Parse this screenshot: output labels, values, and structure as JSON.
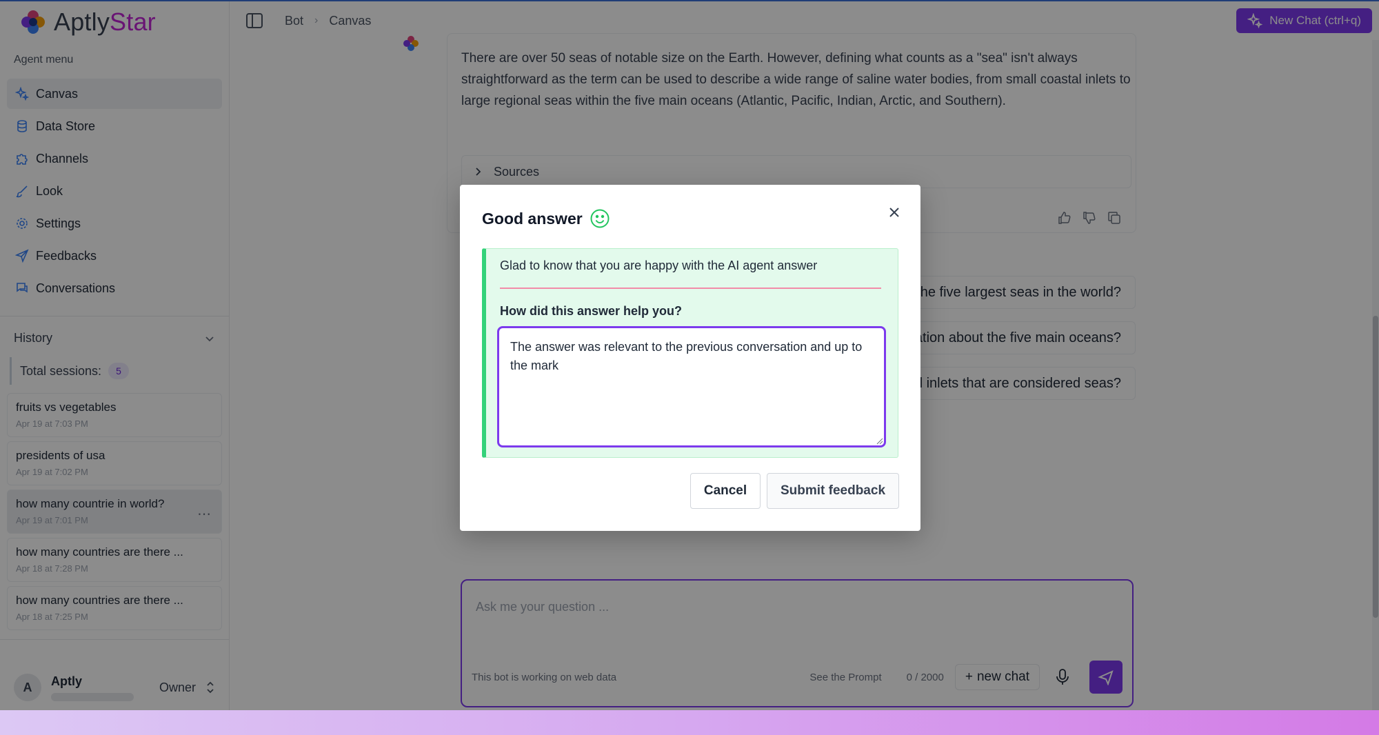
{
  "app": {
    "brand": "AptlyStar",
    "brand_main": "Aptly",
    "brand_accent": "Star",
    "accent_color": "#7c3aed"
  },
  "sidebar": {
    "section_label": "Agent menu",
    "items": [
      {
        "label": "Canvas",
        "icon": "sparkles-icon",
        "active": true
      },
      {
        "label": "Data Store",
        "icon": "database-icon",
        "active": false
      },
      {
        "label": "Channels",
        "icon": "puzzle-icon",
        "active": false
      },
      {
        "label": "Look",
        "icon": "brush-icon",
        "active": false
      },
      {
        "label": "Settings",
        "icon": "gear-icon",
        "active": false
      },
      {
        "label": "Feedbacks",
        "icon": "send-icon",
        "active": false
      },
      {
        "label": "Conversations",
        "icon": "chat-icon",
        "active": false
      }
    ],
    "history_label": "History",
    "total_sessions_label": "Total sessions:",
    "total_sessions_count": "5",
    "sessions": [
      {
        "title": "fruits vs vegetables",
        "date": "Apr 19 at 7:03 PM"
      },
      {
        "title": "presidents of usa",
        "date": "Apr 19 at 7:02 PM"
      },
      {
        "title": "how many countrie in world?",
        "date": "Apr 19 at 7:01 PM",
        "active": true
      },
      {
        "title": "how many countries are there ...",
        "date": "Apr 18 at 7:28 PM"
      },
      {
        "title": "how many countries are there ...",
        "date": "Apr 18 at 7:25 PM"
      }
    ],
    "user": {
      "initial": "A",
      "name": "Aptly",
      "role": "Owner"
    }
  },
  "topbar": {
    "breadcrumbs": [
      "Bot",
      "Canvas"
    ],
    "new_chat_label": "New Chat (ctrl+q)"
  },
  "chat": {
    "answer_text": "There are over 50 seas of notable size on the Earth. However, defining what counts as a \"sea\" isn't always straightforward as the term can be used to describe a wide range of saline water bodies, from small coastal inlets to large regional seas within the five main oceans (Atlantic, Pacific, Indian, Arctic, and Southern).",
    "sources_label": "Sources",
    "suggestions": [
      "What are the five largest seas in the world?",
      "Can you give more information about the five main oceans?",
      "What are some small coastal inlets that are considered seas?"
    ],
    "composer": {
      "placeholder": "Ask me  your question ...",
      "status": "This bot is working on web data",
      "see_prompt": "See the Prompt",
      "char_count": "0 / 2000",
      "new_chat": "new chat"
    }
  },
  "modal": {
    "title": "Good answer",
    "note": "Glad to know that you are happy with the AI agent answer",
    "question": "How did this answer help you?",
    "response": "The answer was relevant to the previous conversation and up to the mark",
    "cancel_label": "Cancel",
    "submit_label": "Submit feedback"
  }
}
